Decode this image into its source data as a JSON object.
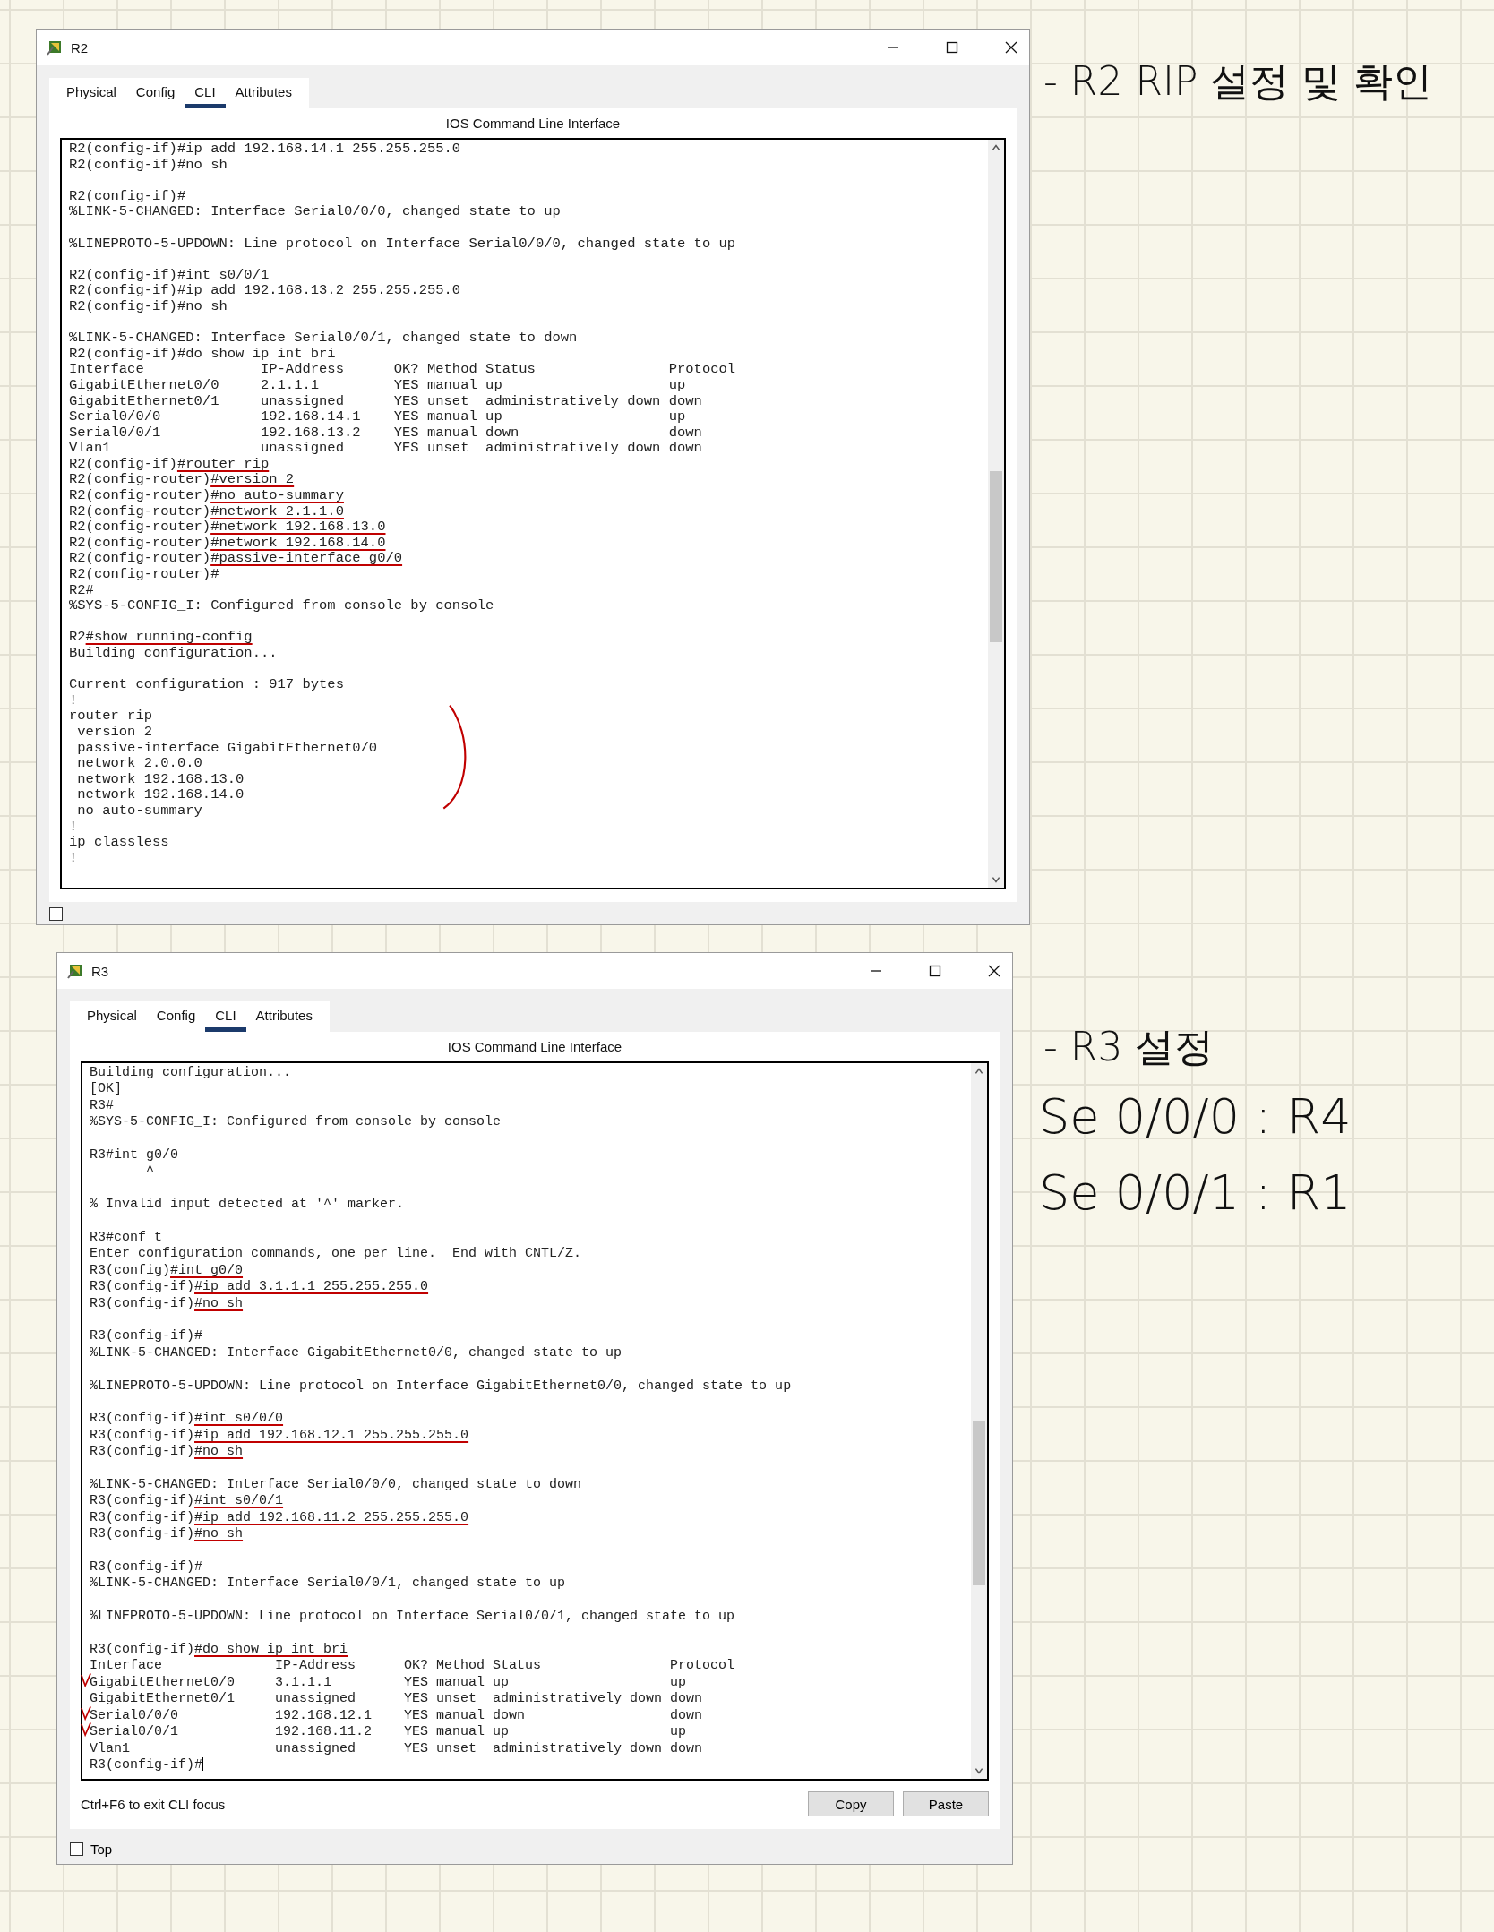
{
  "windows": [
    {
      "title": "R2",
      "tabs": [
        {
          "label": "Physical",
          "selected": false
        },
        {
          "label": "Config",
          "selected": false
        },
        {
          "label": "CLI",
          "selected": true
        },
        {
          "label": "Attributes",
          "selected": false
        }
      ],
      "header": "IOS Command Line Interface",
      "top_checkbox": {
        "checked": false
      },
      "terminal": {
        "blocks": [
          [
            {
              "text": "R2(config-if)#ip add 192.168.14.1 255.255.255.0"
            },
            {
              "text": "R2(config-if)#no sh"
            }
          ],
          [
            {
              "text": "R2(config-if)#"
            },
            {
              "text": "%LINK-5-CHANGED: Interface Serial0/0/0, changed state to up"
            }
          ],
          [
            {
              "text": "%LINEPROTO-5-UPDOWN: Line protocol on Interface Serial0/0/0, changed state to up"
            }
          ],
          [
            {
              "text": "R2(config-if)#int s0/0/1"
            },
            {
              "text": "R2(config-if)#ip add 192.168.13.2 255.255.255.0"
            },
            {
              "text": "R2(config-if)#no sh"
            }
          ],
          [
            {
              "text": "%LINK-5-CHANGED: Interface Serial0/0/1, changed state to down"
            },
            {
              "text": "R2(config-if)#do show ip int bri"
            },
            {
              "text": "Interface              IP-Address      OK? Method Status                Protocol"
            },
            {
              "text": "GigabitEthernet0/0     2.1.1.1         YES manual up                    up"
            },
            {
              "text": "GigabitEthernet0/1     unassigned      YES unset  administratively down down"
            },
            {
              "text": "Serial0/0/0            192.168.14.1    YES manual up                    up"
            },
            {
              "text": "Serial0/0/1            192.168.13.2    YES manual down                  down"
            },
            {
              "text": "Vlan1                  unassigned      YES unset  administratively down down"
            },
            {
              "prompt": "R2(config-if)",
              "command": "#router rip",
              "underlined": true
            },
            {
              "prompt": "R2(config-router)",
              "command": "#version 2",
              "underlined": true
            },
            {
              "prompt": "R2(config-router)",
              "command": "#no auto-summary",
              "underlined": true
            },
            {
              "prompt": "R2(config-router)",
              "command": "#network 2.1.1.0",
              "underlined": true
            },
            {
              "prompt": "R2(config-router)",
              "command": "#network 192.168.13.0",
              "underlined": true
            },
            {
              "prompt": "R2(config-router)",
              "command": "#network 192.168.14.0",
              "underlined": true
            },
            {
              "prompt": "R2(config-router)",
              "command": "#passive-interface g0/0",
              "underlined": true
            },
            {
              "text": "R2(config-router)#"
            },
            {
              "text": "R2#"
            },
            {
              "text": "%SYS-5-CONFIG_I: Configured from console by console"
            }
          ],
          [
            {
              "prompt": "R2",
              "command": "#show running-config",
              "underlined": true
            },
            {
              "text": "Building configuration..."
            }
          ],
          [
            {
              "text": "Current configuration : 917 bytes"
            },
            {
              "text": "!"
            },
            {
              "text": "router rip"
            },
            {
              "text": " version 2"
            },
            {
              "text": " passive-interface GigabitEthernet0/0"
            },
            {
              "text": " network 2.0.0.0"
            },
            {
              "text": " network 192.168.13.0"
            },
            {
              "text": " network 192.168.14.0"
            },
            {
              "text": " no auto-summary"
            },
            {
              "text": "!"
            },
            {
              "text": "ip classless"
            },
            {
              "text": "!"
            }
          ]
        ]
      }
    },
    {
      "title": "R3",
      "tabs": [
        {
          "label": "Physical",
          "selected": false
        },
        {
          "label": "Config",
          "selected": false
        },
        {
          "label": "CLI",
          "selected": true
        },
        {
          "label": "Attributes",
          "selected": false
        }
      ],
      "header": "IOS Command Line Interface",
      "terminal": {
        "blocks": [
          [
            {
              "text": "Building configuration..."
            },
            {
              "text": "[OK]"
            },
            {
              "text": "R3#"
            },
            {
              "text": "%SYS-5-CONFIG_I: Configured from console by console"
            }
          ],
          [
            {
              "text": "R3#int g0/0"
            },
            {
              "text": "       ^"
            }
          ],
          [
            {
              "text": "% Invalid input detected at '^' marker."
            }
          ],
          [
            {
              "text": "R3#conf t"
            },
            {
              "text": "Enter configuration commands, one per line.  End with CNTL/Z."
            },
            {
              "prompt": "R3(config)",
              "command": "#int g0/0",
              "underlined": true
            },
            {
              "prompt": "R3(config-if)",
              "command": "#ip add 3.1.1.1 255.255.255.0",
              "underlined": true
            },
            {
              "prompt": "R3(config-if)",
              "command": "#no sh",
              "underlined": true
            }
          ],
          [
            {
              "text": "R3(config-if)#"
            },
            {
              "text": "%LINK-5-CHANGED: Interface GigabitEthernet0/0, changed state to up"
            }
          ],
          [
            {
              "text": "%LINEPROTO-5-UPDOWN: Line protocol on Interface GigabitEthernet0/0, changed state to up"
            }
          ],
          [
            {
              "prompt": "R3(config-if)",
              "command": "#int s0/0/0",
              "underlined": true
            },
            {
              "prompt": "R3(config-if)",
              "command": "#ip add 192.168.12.1 255.255.255.0",
              "underlined": true
            },
            {
              "prompt": "R3(config-if)",
              "command": "#no sh",
              "underlined": true
            }
          ],
          [
            {
              "text": "%LINK-5-CHANGED: Interface Serial0/0/0, changed state to down"
            },
            {
              "prompt": "R3(config-if)",
              "command": "#int s0/0/1",
              "underlined": true
            },
            {
              "prompt": "R3(config-if)",
              "command": "#ip add 192.168.11.2 255.255.255.0",
              "underlined": true
            },
            {
              "prompt": "R3(config-if)",
              "command": "#no sh",
              "underlined": true
            }
          ],
          [
            {
              "text": "R3(config-if)#"
            },
            {
              "text": "%LINK-5-CHANGED: Interface Serial0/0/1, changed state to up"
            }
          ],
          [
            {
              "text": "%LINEPROTO-5-UPDOWN: Line protocol on Interface Serial0/0/1, changed state to up"
            }
          ],
          [
            {
              "prompt": "R3(config-if)",
              "command": "#do show ip int bri",
              "underlined": true
            },
            {
              "text": "Interface              IP-Address      OK? Method Status                Protocol"
            },
            {
              "text": "GigabitEthernet0/0     3.1.1.1         YES manual up                    up",
              "ticked": true
            },
            {
              "text": "GigabitEthernet0/1     unassigned      YES unset  administratively down down",
              "ticked": false
            },
            {
              "text": "Serial0/0/0            192.168.12.1    YES manual down                  down",
              "ticked": true
            },
            {
              "text": "Serial0/0/1            192.168.11.2    YES manual up                    up",
              "ticked": true
            },
            {
              "text": "Vlan1                  unassigned      YES unset  administratively down down",
              "ticked": false
            },
            {
              "text": "R3(config-if)#",
              "cursor": true
            }
          ]
        ]
      },
      "footer": {
        "hint": "Ctrl+F6 to exit CLI focus",
        "buttons": [
          "Copy",
          "Paste"
        ]
      },
      "top_checkbox": {
        "label": "Top",
        "checked": false
      }
    }
  ],
  "notes": [
    {
      "text": "- R2 RIP 설정 및 확인"
    },
    {
      "text": "- R3 설정"
    },
    {
      "text": "Se 0/0/0 : R4"
    },
    {
      "text": "Se 0/0/1 : R1"
    }
  ]
}
